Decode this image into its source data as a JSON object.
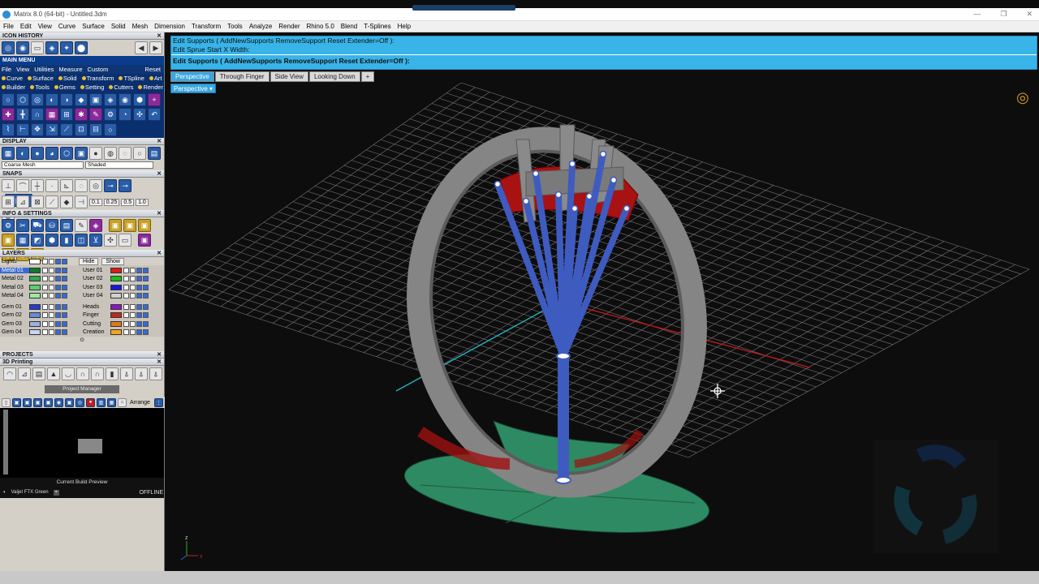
{
  "window": {
    "title": "Matrix 8.0 (64-bit) - Untitled.3dm",
    "controls": [
      "—",
      "❐",
      "✕"
    ]
  },
  "menubar": [
    "File",
    "Edit",
    "View",
    "Curve",
    "Surface",
    "Solid",
    "Mesh",
    "Dimension",
    "Transform",
    "Tools",
    "Analyze",
    "Render",
    "Rhino 5.0",
    "Blend",
    "T-Splines",
    "Help"
  ],
  "sidebar": {
    "icon_history": "ICON HISTORY",
    "main_menu": "MAIN MENU",
    "mm_row1": [
      "File",
      "View",
      "Utilities",
      "Measure",
      "Custom"
    ],
    "mm_reset": "Reset",
    "mm_row2": [
      "Curve",
      "Surface",
      "Solid",
      "Transform",
      "TSpline",
      "Art"
    ],
    "mm_row3": [
      "Builder",
      "Tools",
      "Gems",
      "Setting",
      "Cutters",
      "Render"
    ],
    "display": "DISPLAY",
    "mesh_select": "Coarse Mesh",
    "shade_select": "Shaded",
    "snaps": "SNAPS",
    "snap_values": [
      "0.1",
      "0.25",
      "0.5",
      "1.0"
    ],
    "info_settings": "INFO & SETTINGS",
    "layers": "LAYERS",
    "lights": "Lights",
    "hide": "Hide",
    "show": "Show",
    "layers_left": [
      {
        "name": "Metal 01",
        "color": "#0f7a2a",
        "selected": true
      },
      {
        "name": "Metal 02",
        "color": "#2fa84a"
      },
      {
        "name": "Metal 03",
        "color": "#5ad06a"
      },
      {
        "name": "Metal 04",
        "color": "#9aeaa0"
      },
      {
        "name": "Gem 01",
        "color": "#2a3ad0"
      },
      {
        "name": "Gem 02",
        "color": "#6a8ad8"
      },
      {
        "name": "Gem 03",
        "color": "#9ab0e0"
      },
      {
        "name": "Gem 04",
        "color": "#c8d4f0"
      }
    ],
    "layers_right": [
      {
        "name": "User 01",
        "color": "#e01818"
      },
      {
        "name": "User 02",
        "color": "#18c018"
      },
      {
        "name": "User 03",
        "color": "#1818e0"
      },
      {
        "name": "User 04",
        "color": "#d0d0d0"
      },
      {
        "name": "Heads",
        "color": "#8a18c0"
      },
      {
        "name": "Finger",
        "color": "#c02818"
      },
      {
        "name": "Cutting",
        "color": "#e07818"
      },
      {
        "name": "Creation",
        "color": "#f0a818"
      }
    ],
    "projects": "PROJECTS",
    "printing": "3D Printing",
    "project_manager": "Project Manager",
    "arrange": "Arrange",
    "build_preview": "Current Build Preview",
    "printer": "Vaijet FTX Green",
    "status": "OFFLINE"
  },
  "command": {
    "line1": "Edit Supports ( AddNewSupports  RemoveSupport  Reset  Extender=Off ):",
    "line2": "Edit Sprue Start X Width:",
    "current": "Edit Supports ( AddNewSupports  RemoveSupport  Reset  Extender=Off ):"
  },
  "viewtabs": [
    "Perspective",
    "Through Finger",
    "Side View",
    "Looking Down"
  ],
  "viewtab_add": "+",
  "viewport": {
    "label": "Perspective",
    "axis_z": "z",
    "axis_x": "x"
  },
  "colors": {
    "accent": "#3aa6e0",
    "ring": "#8c8c8c",
    "support": "#3e5bc0",
    "base": "#2e8a62",
    "red": "#b01010"
  }
}
